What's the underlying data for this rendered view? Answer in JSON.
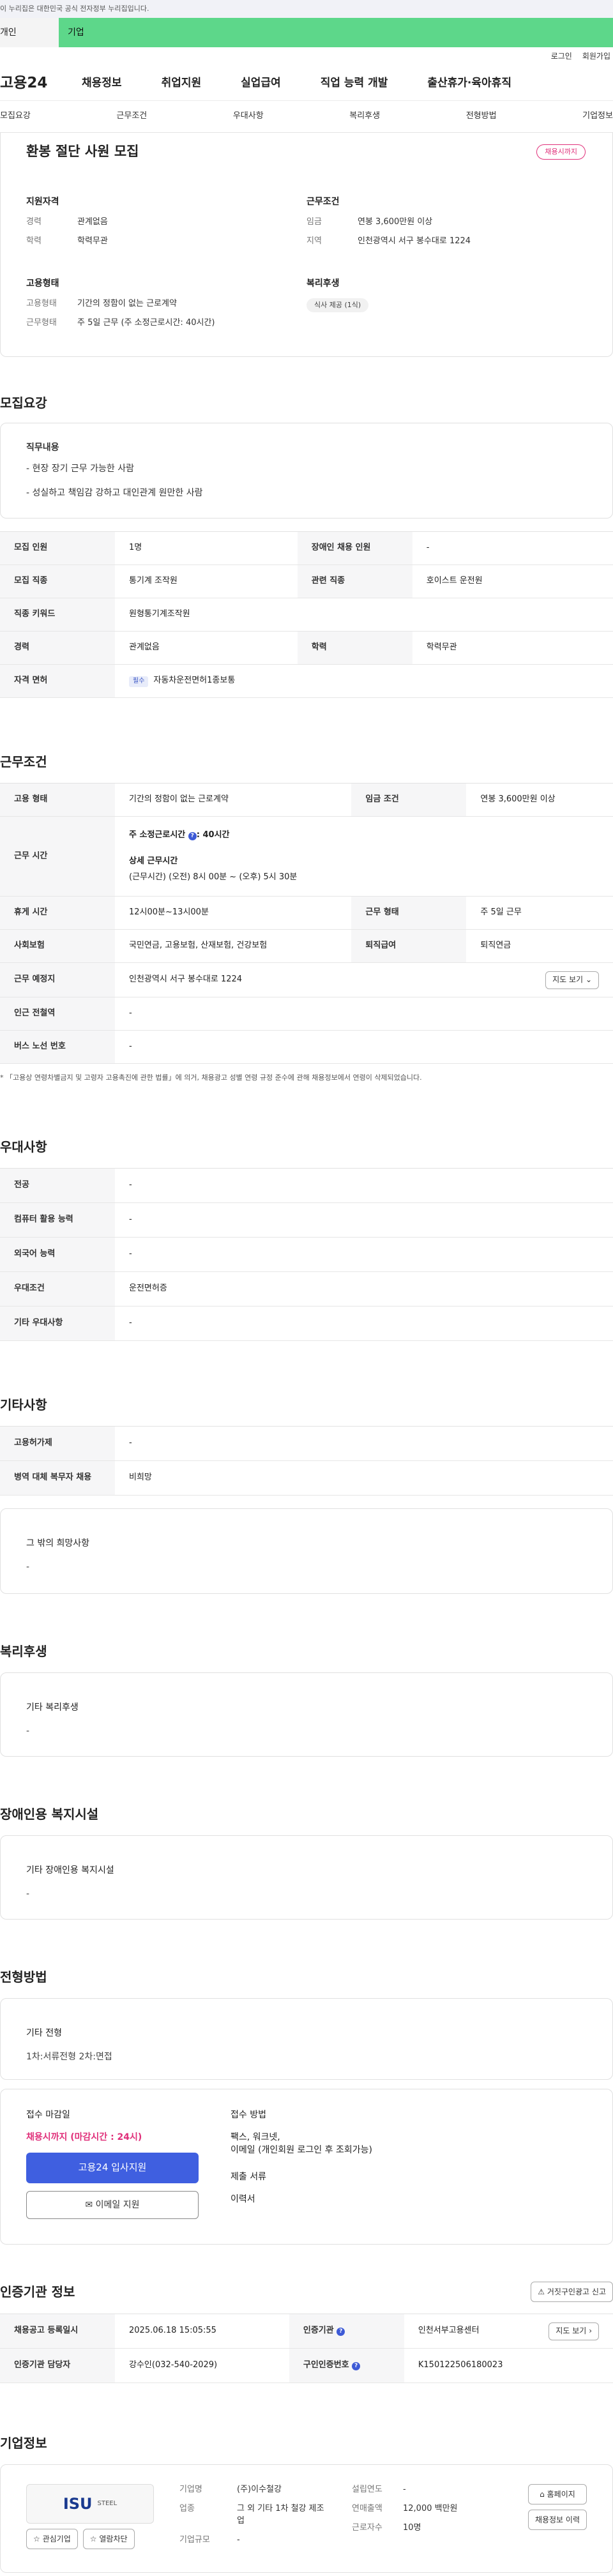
{
  "gov_banner": "이 누리집은 대한민국 공식 전자정부 누리집입니다.",
  "user_tabs": [
    "개인",
    "기업"
  ],
  "util": [
    "로그인",
    "회원가입"
  ],
  "logo": "고용24",
  "gnb": [
    "채용정보",
    "취업지원",
    "실업급여",
    "직업 능력 개발",
    "출산휴가·육아휴직"
  ],
  "anchors": [
    "모집요강",
    "근무조건",
    "우대사항",
    "복리후생",
    "전형방법",
    "기업정보"
  ],
  "job": {
    "title": "환봉 절단 사원 모집",
    "status": "채용시까지",
    "qual_head": "지원자격",
    "qual": [
      [
        "경력",
        "관계없음"
      ],
      [
        "학력",
        "학력무관"
      ]
    ],
    "type_head": "고용형태",
    "types": [
      [
        "고용형태",
        "기간의 정함이 없는 근로계약"
      ],
      [
        "근무형태",
        "주 5일 근무 (주 소정근로시간: 40시간)"
      ]
    ],
    "cond_head": "근무조건",
    "conds": [
      [
        "임금",
        "연봉 3,600만원 이상"
      ],
      [
        "지역",
        "인천광역시 서구 봉수대로 1224"
      ]
    ],
    "wel_head": "복리후생",
    "wel_chip": "식사 제공 (1식)"
  },
  "recruit": {
    "title": "모집요강",
    "duty_head": "직무내용",
    "duty": [
      "- 현장 장기 근무 가능한 사람",
      "- 성실하고 책임감 강하고 대인관계 원만한 사람"
    ],
    "rows": [
      [
        "모집 인원",
        "1명",
        "장애인 채용 인원",
        "-"
      ],
      [
        "모집 직종",
        "통기계 조작원",
        "관련 직종",
        "호이스트 운전원"
      ],
      [
        "직종 키워드",
        "원형통기계조작원",
        "",
        ""
      ],
      [
        "경력",
        "관계없음",
        "학력",
        "학력무관"
      ]
    ],
    "license_label": "자격 면허",
    "license_tag": "필수",
    "license": "자동차운전면허1종보통"
  },
  "work": {
    "title": "근무조건",
    "r1": [
      "고용 형태",
      "기간의 정함이 없는 근로계약",
      "임금 조건",
      "연봉 3,600만원 이상"
    ],
    "hours_label": "근무 시간",
    "hours_main": "주 소정근로시간",
    "hours_val": ": 40시간",
    "detail_head": "상세 근무시간",
    "detail": "(근무시간) (오전) 8시 00분 ~ (오후) 5시 30분",
    "r3": [
      "휴게 시간",
      "12시00분~13시00분",
      "근무 형태",
      "주 5일 근무"
    ],
    "r4": [
      "사회보험",
      "국민연금, 고용보험, 산재보험, 건강보험",
      "퇴직급여",
      "퇴직연금"
    ],
    "place_label": "근무 예정지",
    "place": "인천광역시 서구 봉수대로 1224",
    "map_btn": "지도 보기",
    "r6": [
      "인근 전철역",
      "-"
    ],
    "r7": [
      "버스 노선 번호",
      "-"
    ],
    "note": "* 「고용상 연령차별금지 및 고령자 고용촉진에 관한 법률」에 의거, 채용광고 성별 연령 규정 준수에 관해 채용정보에서 연령이 삭제되었습니다."
  },
  "pref": {
    "title": "우대사항",
    "rows": [
      [
        "전공",
        "-"
      ],
      [
        "컴퓨터 활용 능력",
        "-"
      ],
      [
        "외국어 능력",
        "-"
      ],
      [
        "우대조건",
        "운전면허증"
      ],
      [
        "기타 우대사항",
        "-"
      ]
    ]
  },
  "other": {
    "title": "기타사항",
    "rows": [
      [
        "고용허가제",
        "-"
      ],
      [
        "병역 대체 복무자 채용",
        "비희망"
      ]
    ],
    "wish_head": "그 밖의 희망사항",
    "wish": "-"
  },
  "welfare": {
    "title": "복리후생",
    "head": "기타 복리후생",
    "val": "-"
  },
  "disab": {
    "title": "장애인용 복지시설",
    "head": "기타 장애인용 복지시설",
    "val": "-"
  },
  "selection": {
    "title": "전형방법",
    "head": "기타 전형",
    "val": "1차:서류전형 2차:면접",
    "deadline_head": "접수 마감일",
    "deadline": "채용시까지 (마감시간 : 24시)",
    "apply_btn": "고용24 입사지원",
    "email_btn": "이메일 지원",
    "method_head": "접수 방법",
    "methods": [
      "팩스, 워크넷,",
      "이메일 (개인회원 로그인 후 조회가능)"
    ],
    "docs_head": "제출 서류",
    "docs": "이력서"
  },
  "org": {
    "title": "인증기관 정보",
    "report_btn": "거짓구인광고 신고",
    "r1": [
      "채용공고 등록일시",
      "2025.06.18 15:05:55",
      "인증기관",
      "인천서부고용센터"
    ],
    "map_btn": "지도 보기",
    "r2": [
      "인증기관 담당자",
      "강수인(032-540-2029)",
      "구인인증번호",
      "K150122506180023"
    ]
  },
  "company": {
    "title": "기업정보",
    "logo_text": "ISU",
    "logo_sub": "STEEL",
    "fav_btn": "관심기업",
    "block_btn": "열람차단",
    "name_k": "기업명",
    "name": "(주)이수철강",
    "ind_k": "업종",
    "ind": "그 외 기타 1차 철강 제조업",
    "size_k": "기업규모",
    "size": "-",
    "est_k": "설립연도",
    "est": "-",
    "sales_k": "연매출액",
    "sales": "12,000 백만원",
    "emp_k": "근로자수",
    "emp": "10명",
    "home_btn": "홈페이지",
    "hist_btn": "채용정보 이력"
  }
}
